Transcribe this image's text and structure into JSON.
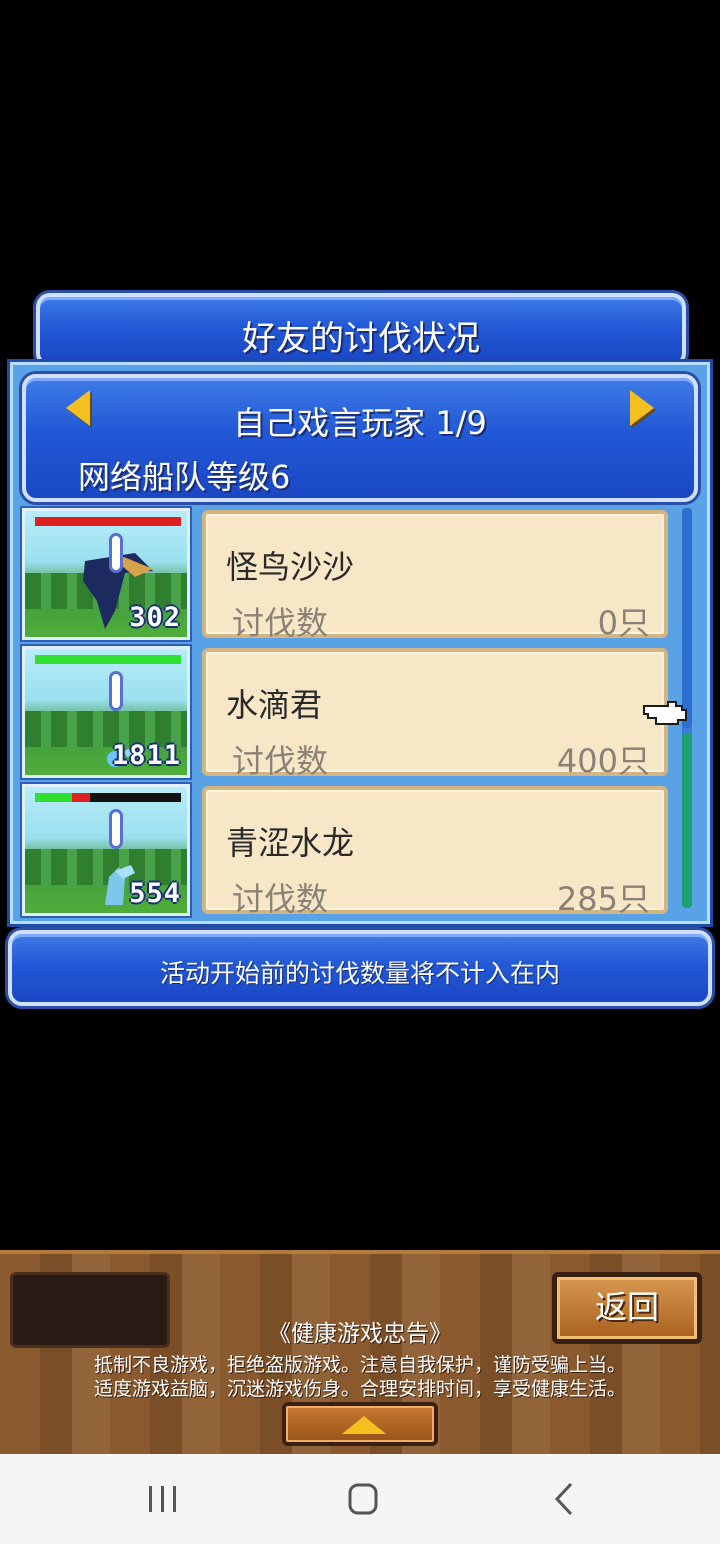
{
  "title": "好友的讨伐状况",
  "player": {
    "name": "自己戏言玩家 1/9",
    "fleet_level": "网络船队等级6"
  },
  "list": {
    "kill_label": "讨伐数",
    "items": [
      {
        "name": "怪鸟沙沙",
        "kill_count": "0只",
        "badge": "302",
        "hp_color": "#e02020",
        "hp_fill": 1.0
      },
      {
        "name": "水滴君",
        "kill_count": "400只",
        "badge": "1811",
        "hp_color": "#30e030",
        "hp_fill": 1.0
      },
      {
        "name": "青涩水龙",
        "kill_count": "285只",
        "badge": "554",
        "hp_color": "#30e030",
        "hp_fill": 0.25
      }
    ]
  },
  "notice": "活动开始前的讨伐数量将不计入在内",
  "footer": {
    "back_label": "返回",
    "advice_title": "《健康游戏忠告》",
    "advice_line1": "抵制不良游戏，拒绝盗版游戏。注意自我保护，谨防受骗上当。",
    "advice_line2": "适度游戏益脑，沉迷游戏伤身。合理安排时间，享受健康生活。"
  },
  "icons": {
    "prev": "triangle-left-icon",
    "next": "triangle-right-icon",
    "cursor": "pointing-hand-icon",
    "expand": "triangle-up-icon",
    "nav_recent": "recent-apps-icon",
    "nav_home": "home-icon",
    "nav_back": "back-icon"
  }
}
